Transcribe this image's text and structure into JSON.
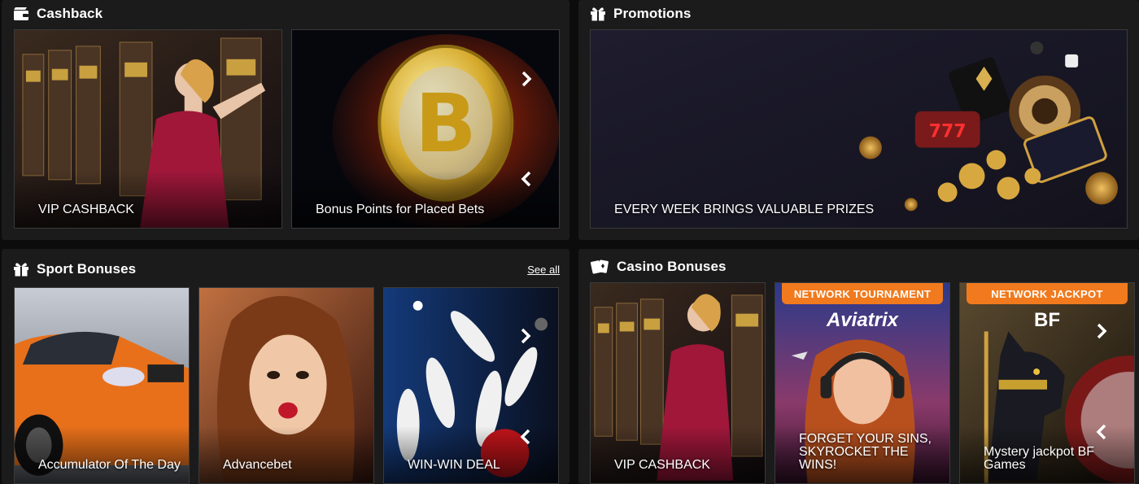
{
  "cashback": {
    "title": "Cashback",
    "cards": [
      {
        "caption": "VIP CASHBACK"
      },
      {
        "caption": "Bonus Points for Placed Bets"
      }
    ]
  },
  "promotions": {
    "title": "Promotions",
    "cards": [
      {
        "caption": "EVERY WEEK BRINGS VALUABLE PRIZES"
      }
    ]
  },
  "sport": {
    "title": "Sport Bonuses",
    "see_all": "See all",
    "cards": [
      {
        "caption": "Accumulator Of The Day"
      },
      {
        "caption": "Advancebet"
      },
      {
        "caption": "WIN-WIN DEAL"
      }
    ]
  },
  "casino": {
    "title": "Casino Bonuses",
    "cards": [
      {
        "caption": "VIP CASHBACK"
      },
      {
        "caption": "FORGET YOUR SINS, SKYROCKET THE WINS!",
        "badge": "NETWORK TOURNAMENT",
        "brand": "Aviatrix"
      },
      {
        "caption": "Mystery jackpot BF Games",
        "badge": "NETWORK JACKPOT",
        "brand": "BF"
      }
    ]
  }
}
